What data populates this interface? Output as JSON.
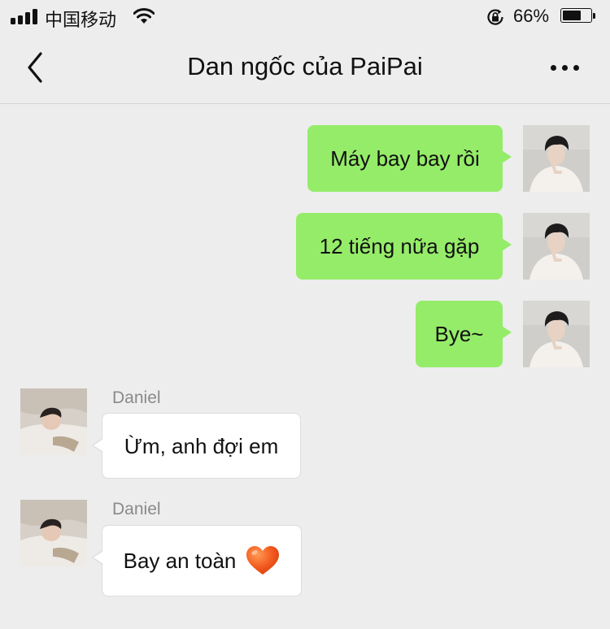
{
  "status_bar": {
    "carrier": "中国移动",
    "battery_percent": "66%",
    "battery_level": 0.66,
    "icons": [
      "signal-icon",
      "wifi-icon",
      "rotation-lock-icon",
      "battery-icon"
    ]
  },
  "nav": {
    "title": "Dan ngốc của PaiPai",
    "back_icon": "chevron-left-icon",
    "more_icon": "more-dots-icon"
  },
  "messages": [
    {
      "direction": "out",
      "text": "Máy bay bay rồi"
    },
    {
      "direction": "out",
      "text": "12 tiếng nữa gặp"
    },
    {
      "direction": "out",
      "text": "Bye~"
    },
    {
      "direction": "in",
      "sender": "Daniel",
      "text": "Ừm, anh đợi em"
    },
    {
      "direction": "in",
      "sender": "Daniel",
      "text": "Bay an toàn",
      "emoji": "orange-heart-icon"
    }
  ],
  "colors": {
    "background": "#ededed",
    "outgoing_bubble": "#95ec69",
    "incoming_bubble": "#ffffff",
    "heart": "#f25a1e"
  }
}
